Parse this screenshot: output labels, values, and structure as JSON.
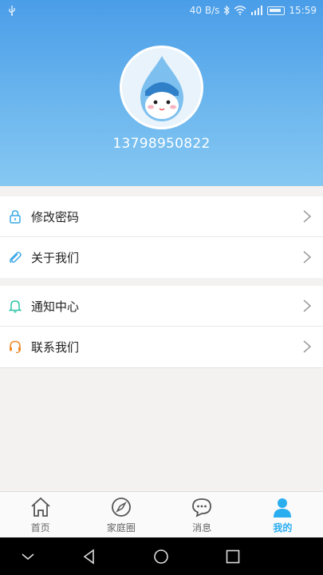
{
  "status_bar": {
    "speed": "40 B/s",
    "time": "15:59"
  },
  "profile": {
    "phone": "13798950822"
  },
  "menu": {
    "group1": [
      {
        "label": "修改密码",
        "icon": "lock-icon"
      },
      {
        "label": "关于我们",
        "icon": "paperclip-icon"
      }
    ],
    "group2": [
      {
        "label": "通知中心",
        "icon": "bell-icon"
      },
      {
        "label": "联系我们",
        "icon": "headset-icon"
      }
    ]
  },
  "tabs": [
    {
      "label": "首页",
      "icon": "home-icon"
    },
    {
      "label": "家庭圈",
      "icon": "compass-icon"
    },
    {
      "label": "消息",
      "icon": "chat-bubble-icon"
    },
    {
      "label": "我的",
      "icon": "person-icon",
      "active": true
    }
  ],
  "colors": {
    "header_top": "#4a9de8",
    "header_bottom": "#86c8f2",
    "active_tab": "#2aaef0",
    "background": "#f3f2f1"
  }
}
